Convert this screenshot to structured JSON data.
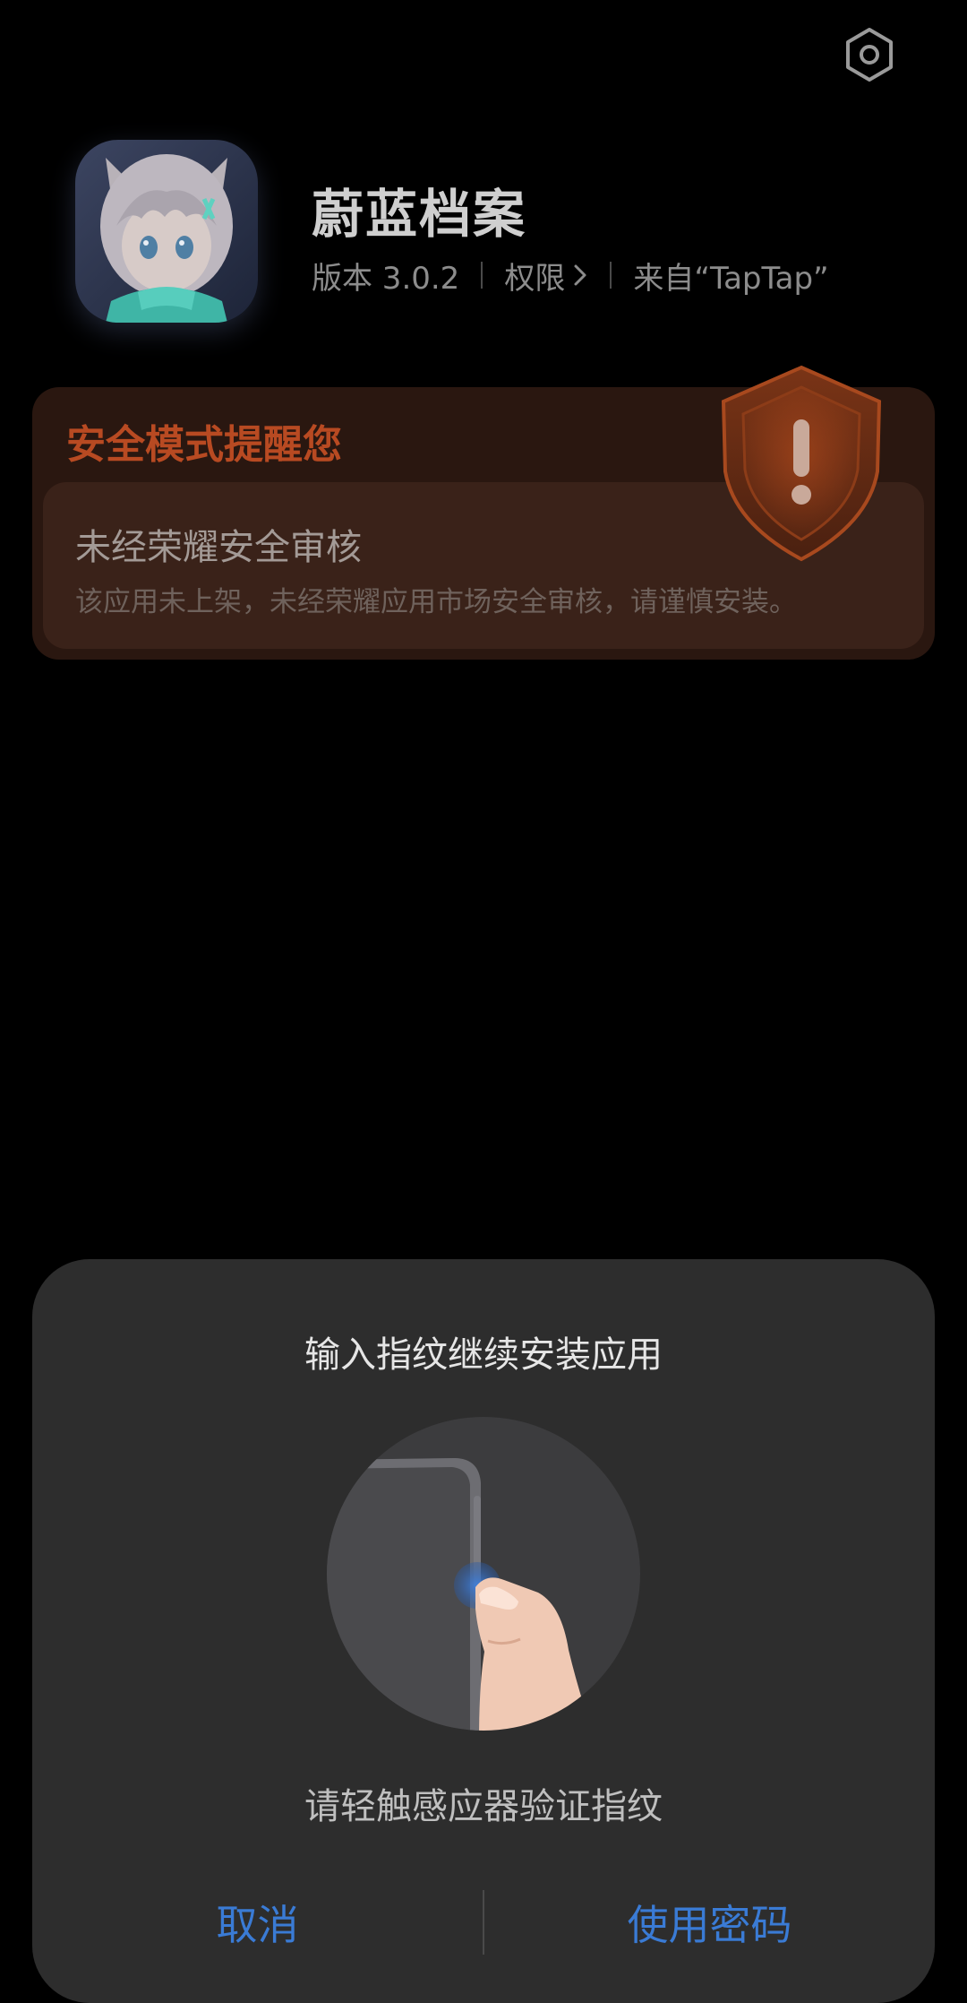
{
  "header": {
    "settings_icon": "gear-icon"
  },
  "app": {
    "name": "蔚蓝档案",
    "icon": "app-icon-anime-girl",
    "version": "版本 3.0.2",
    "permissions_label": "权限",
    "source": "来自“TapTap”"
  },
  "security_notice": {
    "title": "安全模式提醒您",
    "subtitle": "未经荣耀安全审核",
    "description": "该应用未上架，未经荣耀应用市场安全审核，请谨慎安装。",
    "icon": "shield-warning-icon",
    "accent_color": "#b84a22"
  },
  "fingerprint_dialog": {
    "title": "输入指纹继续安装应用",
    "hint": "请轻触感应器验证指纹",
    "illustration": "fingerprint-side-sensor-illustration",
    "cancel_label": "取消",
    "password_label": "使用密码",
    "action_color": "#3a7bd5"
  }
}
